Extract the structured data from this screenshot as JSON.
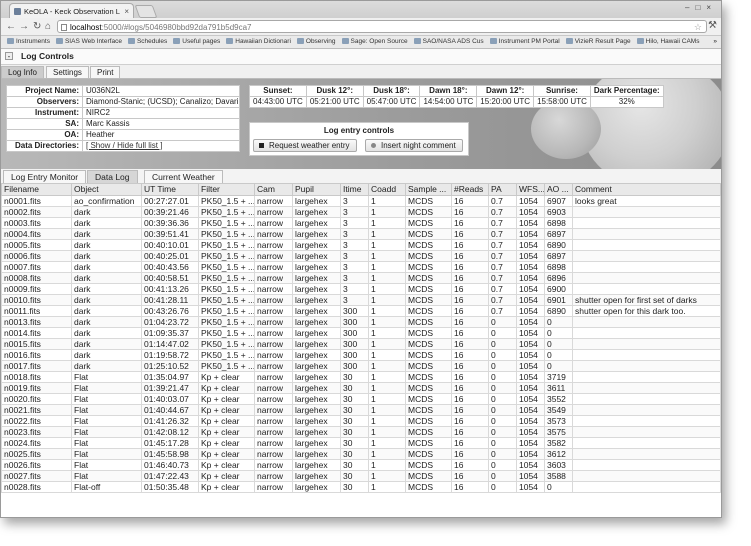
{
  "browser": {
    "tab_title": "KeOLA - Keck Observation L",
    "tab_close": "×",
    "url_host": "localhost",
    "url_path": ":5000/#logs/5046980bbd92da791b5d9ca7",
    "bookmarks": [
      "Instruments",
      "SIAS Web Interface",
      "Schedules",
      "Useful pages",
      "Hawaiian Dictionari",
      "Observing",
      "Sage: Open Source",
      "SAO/NASA ADS Cus",
      "Instrument PM Portal",
      "VizieR Result Page",
      "Hilo, Hawaii CAMs"
    ],
    "bookmarks_more": "»"
  },
  "log_controls": {
    "toggle": "-",
    "title": "Log Controls",
    "tabs": [
      "Log Info",
      "Settings",
      "Print"
    ]
  },
  "info": {
    "rows": [
      {
        "label": "Project Name:",
        "value": "U036N2L"
      },
      {
        "label": "Observers:",
        "value": "Diamond-Stanic; (UCSD); Canalizo; Davari"
      },
      {
        "label": "Instrument:",
        "value": "NIRC2"
      },
      {
        "label": "SA:",
        "value": "Marc Kassis"
      },
      {
        "label": "OA:",
        "value": "Heather"
      }
    ],
    "dir_label": "Data Directories:",
    "dir_link": "[ Show / Hide full list ]"
  },
  "sun": {
    "headers": [
      "Sunset:",
      "Dusk 12°:",
      "Dusk 18°:",
      "Dawn 18°:",
      "Dawn 12°:",
      "Sunrise:",
      "Dark Percentage:"
    ],
    "values": [
      "04:43:00 UTC",
      "05:21:00 UTC",
      "05:47:00 UTC",
      "14:54:00 UTC",
      "15:20:00 UTC",
      "15:58:00 UTC",
      "32%"
    ]
  },
  "entry_controls": {
    "title": "Log entry controls",
    "weather_button": "Request weather entry",
    "night_button": "Insert night comment"
  },
  "lower_tabs": [
    "Log Entry Monitor",
    "Data Log",
    "Current Weather"
  ],
  "grid": {
    "columns": [
      "Filename",
      "Object",
      "UT Time",
      "Filter",
      "Cam",
      "Pupil",
      "Itime",
      "Coadd",
      "Sample ...",
      "#Reads",
      "PA",
      "WFS...",
      "AO ...",
      "Comment"
    ],
    "rows": [
      [
        "n0001.fits",
        "ao_confirmation",
        "00:27:27.01",
        "PK50_1.5 + ...",
        "narrow",
        "largehex",
        "3",
        "1",
        "MCDS",
        "16",
        "0.7",
        "1054",
        "6907",
        "looks great"
      ],
      [
        "n0002.fits",
        "dark",
        "00:39:21.46",
        "PK50_1.5 + ...",
        "narrow",
        "largehex",
        "3",
        "1",
        "MCDS",
        "16",
        "0.7",
        "1054",
        "6903",
        ""
      ],
      [
        "n0003.fits",
        "dark",
        "00:39:36.36",
        "PK50_1.5 + ...",
        "narrow",
        "largehex",
        "3",
        "1",
        "MCDS",
        "16",
        "0.7",
        "1054",
        "6898",
        ""
      ],
      [
        "n0004.fits",
        "dark",
        "00:39:51.41",
        "PK50_1.5 + ...",
        "narrow",
        "largehex",
        "3",
        "1",
        "MCDS",
        "16",
        "0.7",
        "1054",
        "6897",
        ""
      ],
      [
        "n0005.fits",
        "dark",
        "00:40:10.01",
        "PK50_1.5 + ...",
        "narrow",
        "largehex",
        "3",
        "1",
        "MCDS",
        "16",
        "0.7",
        "1054",
        "6890",
        ""
      ],
      [
        "n0006.fits",
        "dark",
        "00:40:25.01",
        "PK50_1.5 + ...",
        "narrow",
        "largehex",
        "3",
        "1",
        "MCDS",
        "16",
        "0.7",
        "1054",
        "6897",
        ""
      ],
      [
        "n0007.fits",
        "dark",
        "00:40:43.56",
        "PK50_1.5 + ...",
        "narrow",
        "largehex",
        "3",
        "1",
        "MCDS",
        "16",
        "0.7",
        "1054",
        "6898",
        ""
      ],
      [
        "n0008.fits",
        "dark",
        "00:40:58.51",
        "PK50_1.5 + ...",
        "narrow",
        "largehex",
        "3",
        "1",
        "MCDS",
        "16",
        "0.7",
        "1054",
        "6896",
        ""
      ],
      [
        "n0009.fits",
        "dark",
        "00:41:13.26",
        "PK50_1.5 + ...",
        "narrow",
        "largehex",
        "3",
        "1",
        "MCDS",
        "16",
        "0.7",
        "1054",
        "6900",
        ""
      ],
      [
        "n0010.fits",
        "dark",
        "00:41:28.11",
        "PK50_1.5 + ...",
        "narrow",
        "largehex",
        "3",
        "1",
        "MCDS",
        "16",
        "0.7",
        "1054",
        "6901",
        "shutter open for first set of darks"
      ],
      [
        "n0011.fits",
        "dark",
        "00:43:26.76",
        "PK50_1.5 + ...",
        "narrow",
        "largehex",
        "300",
        "1",
        "MCDS",
        "16",
        "0.7",
        "1054",
        "6890",
        "shutter open for this dark too."
      ],
      [
        "n0013.fits",
        "dark",
        "01:04:23.72",
        "PK50_1.5 + ...",
        "narrow",
        "largehex",
        "300",
        "1",
        "MCDS",
        "16",
        "0",
        "1054",
        "0",
        ""
      ],
      [
        "n0014.fits",
        "dark",
        "01:09:35.37",
        "PK50_1.5 + ...",
        "narrow",
        "largehex",
        "300",
        "1",
        "MCDS",
        "16",
        "0",
        "1054",
        "0",
        ""
      ],
      [
        "n0015.fits",
        "dark",
        "01:14:47.02",
        "PK50_1.5 + ...",
        "narrow",
        "largehex",
        "300",
        "1",
        "MCDS",
        "16",
        "0",
        "1054",
        "0",
        ""
      ],
      [
        "n0016.fits",
        "dark",
        "01:19:58.72",
        "PK50_1.5 + ...",
        "narrow",
        "largehex",
        "300",
        "1",
        "MCDS",
        "16",
        "0",
        "1054",
        "0",
        ""
      ],
      [
        "n0017.fits",
        "dark",
        "01:25:10.52",
        "PK50_1.5 + ...",
        "narrow",
        "largehex",
        "300",
        "1",
        "MCDS",
        "16",
        "0",
        "1054",
        "0",
        ""
      ],
      [
        "n0018.fits",
        "Flat",
        "01:35:04.97",
        "Kp + clear",
        "narrow",
        "largehex",
        "30",
        "1",
        "MCDS",
        "16",
        "0",
        "1054",
        "3719",
        ""
      ],
      [
        "n0019.fits",
        "Flat",
        "01:39:21.47",
        "Kp + clear",
        "narrow",
        "largehex",
        "30",
        "1",
        "MCDS",
        "16",
        "0",
        "1054",
        "3611",
        ""
      ],
      [
        "n0020.fits",
        "Flat",
        "01:40:03.07",
        "Kp + clear",
        "narrow",
        "largehex",
        "30",
        "1",
        "MCDS",
        "16",
        "0",
        "1054",
        "3552",
        ""
      ],
      [
        "n0021.fits",
        "Flat",
        "01:40:44.67",
        "Kp + clear",
        "narrow",
        "largehex",
        "30",
        "1",
        "MCDS",
        "16",
        "0",
        "1054",
        "3549",
        ""
      ],
      [
        "n0022.fits",
        "Flat",
        "01:41:26.32",
        "Kp + clear",
        "narrow",
        "largehex",
        "30",
        "1",
        "MCDS",
        "16",
        "0",
        "1054",
        "3573",
        ""
      ],
      [
        "n0023.fits",
        "Flat",
        "01:42:08.12",
        "Kp + clear",
        "narrow",
        "largehex",
        "30",
        "1",
        "MCDS",
        "16",
        "0",
        "1054",
        "3575",
        ""
      ],
      [
        "n0024.fits",
        "Flat",
        "01:45:17.28",
        "Kp + clear",
        "narrow",
        "largehex",
        "30",
        "1",
        "MCDS",
        "16",
        "0",
        "1054",
        "3582",
        ""
      ],
      [
        "n0025.fits",
        "Flat",
        "01:45:58.98",
        "Kp + clear",
        "narrow",
        "largehex",
        "30",
        "1",
        "MCDS",
        "16",
        "0",
        "1054",
        "3612",
        ""
      ],
      [
        "n0026.fits",
        "Flat",
        "01:46:40.73",
        "Kp + clear",
        "narrow",
        "largehex",
        "30",
        "1",
        "MCDS",
        "16",
        "0",
        "1054",
        "3603",
        ""
      ],
      [
        "n0027.fits",
        "Flat",
        "01:47:22.43",
        "Kp + clear",
        "narrow",
        "largehex",
        "30",
        "1",
        "MCDS",
        "16",
        "0",
        "1054",
        "3588",
        ""
      ],
      [
        "n0028.fits",
        "Flat-off",
        "01:50:35.48",
        "Kp + clear",
        "narrow",
        "largehex",
        "30",
        "1",
        "MCDS",
        "16",
        "0",
        "1054",
        "0",
        ""
      ]
    ]
  }
}
